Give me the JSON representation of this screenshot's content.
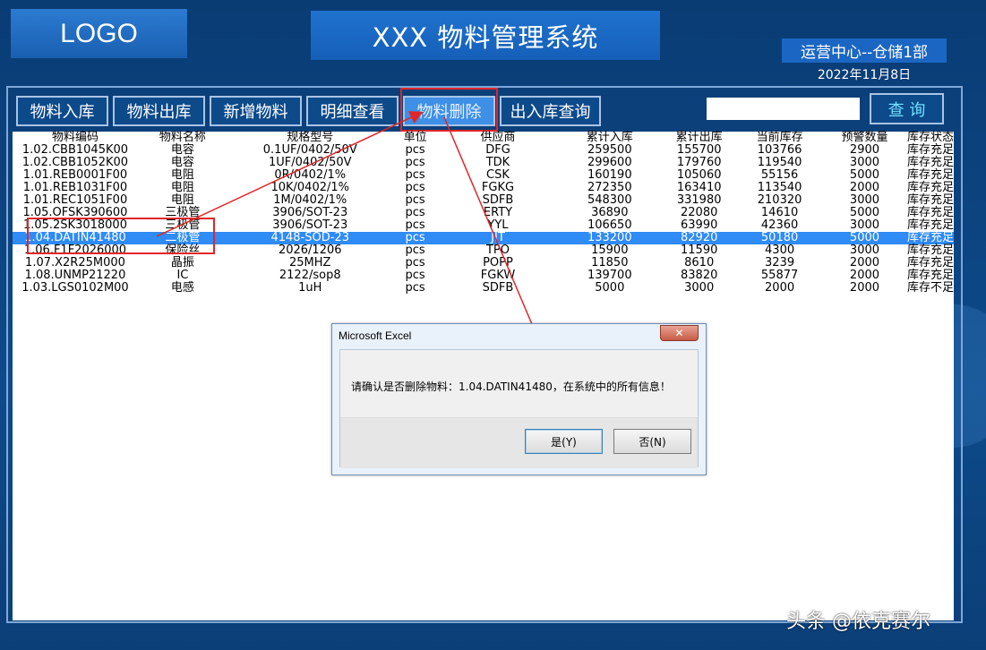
{
  "header": {
    "logo": "LOGO",
    "title": "XXX 物料管理系统",
    "department": "运营中心--仓储1部",
    "date": "2022年11月8日"
  },
  "toolbar": {
    "buttons": [
      "物料入库",
      "物料出库",
      "新增物料",
      "明细查看",
      "物料删除",
      "出入库查询"
    ],
    "active": "物料删除",
    "search_value": "",
    "search_label": "查 询"
  },
  "table": {
    "columns": [
      "物料编码",
      "物料名称",
      "规格型号",
      "单位",
      "供应商",
      "累计入库",
      "累计出库",
      "当前库存",
      "预警数量",
      "库存状态"
    ],
    "rows": [
      [
        "1.02.CBB1045K00",
        "电容",
        "0.1UF/0402/50V",
        "pcs",
        "DFG",
        "259500",
        "155700",
        "103766",
        "2900",
        "库存充足"
      ],
      [
        "1.02.CBB1052K00",
        "电容",
        "1UF/0402/50V",
        "pcs",
        "TDK",
        "299600",
        "179760",
        "119540",
        "3000",
        "库存充足"
      ],
      [
        "1.01.REB0001F00",
        "电阻",
        "0R/0402/1%",
        "pcs",
        "CSK",
        "160190",
        "105060",
        "55156",
        "5000",
        "库存充足"
      ],
      [
        "1.01.REB1031F00",
        "电阻",
        "10K/0402/1%",
        "pcs",
        "FGKG",
        "272350",
        "163410",
        "113540",
        "2000",
        "库存充足"
      ],
      [
        "1.01.REC1051F00",
        "电阻",
        "1M/0402/1%",
        "pcs",
        "SDFB",
        "548300",
        "331980",
        "210320",
        "3000",
        "库存充足"
      ],
      [
        "1.05.OFSK390600",
        "三极管",
        "3906/SOT-23",
        "pcs",
        "ERTY",
        "36890",
        "22080",
        "14610",
        "5000",
        "库存充足"
      ],
      [
        "1.05.2SK3018000",
        "三极管",
        "3906/SOT-23",
        "pcs",
        "YYL",
        "106650",
        "63990",
        "42360",
        "3000",
        "库存充足"
      ],
      [
        "1.04.DATIN41480",
        "二极管",
        "4148-SOD-23",
        "pcs",
        "JIT",
        "133200",
        "82920",
        "50180",
        "5000",
        "库存充足"
      ],
      [
        "1.06.F1F2026000",
        "保险丝",
        "2026/1206",
        "pcs",
        "TPO",
        "15900",
        "11590",
        "4300",
        "3000",
        "库存充足"
      ],
      [
        "1.07.X2R25M000",
        "晶振",
        "25MHZ",
        "pcs",
        "POPP",
        "11850",
        "8610",
        "3239",
        "2000",
        "库存充足"
      ],
      [
        "1.08.UNMP21220",
        "IC",
        "2122/sop8",
        "pcs",
        "FGKW",
        "139700",
        "83820",
        "55877",
        "2000",
        "库存充足"
      ],
      [
        "1.03.LGS0102M00",
        "电感",
        "1uH",
        "pcs",
        "SDFB",
        "5000",
        "3000",
        "2000",
        "2000",
        "库存不足"
      ]
    ],
    "selected_row": 7
  },
  "dialog": {
    "title": "Microsoft Excel",
    "close": "✕",
    "message": "请确认是否删除物料：1.04.DATIN41480，在系统中的所有信息！",
    "yes": "是(Y)",
    "no": "否(N)"
  },
  "watermark": "头条 @依克赛尔"
}
